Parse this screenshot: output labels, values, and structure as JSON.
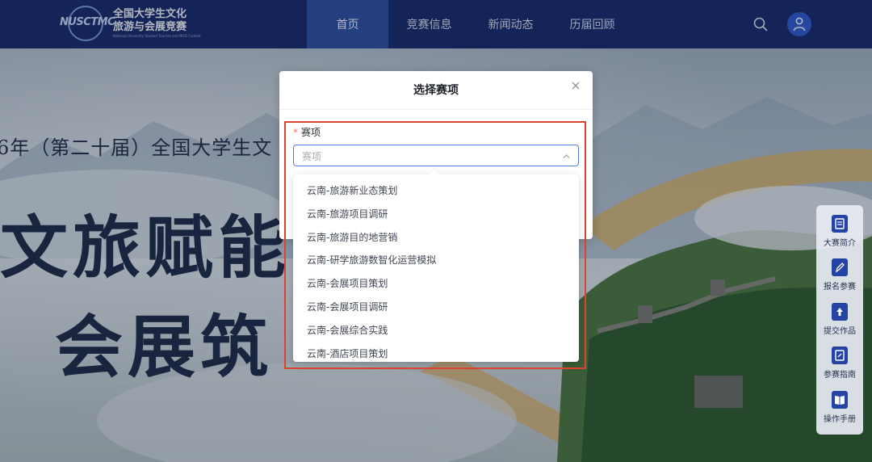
{
  "header": {
    "logo_abbr": "NUSCTMC",
    "logo_line1": "全国大学生文化",
    "logo_line2": "旅游与会展竞赛",
    "logo_line3": "National University Student Tourism and MICE Contest",
    "nav": [
      {
        "label": "首页",
        "active": true
      },
      {
        "label": "竞赛信息",
        "active": false
      },
      {
        "label": "新闻动态",
        "active": false
      },
      {
        "label": "历届回顾",
        "active": false
      }
    ]
  },
  "hero": {
    "subtitle": "6年（第二十届）全国大学生文",
    "line1": "文旅赋能",
    "line2": "会展筑"
  },
  "dialog": {
    "title": "选择赛项",
    "field_label": "赛项",
    "select_placeholder": "赛项",
    "options": [
      "云南-旅游新业态策划",
      "云南-旅游项目调研",
      "云南-旅游目的地营销",
      "云南-研学旅游数智化运营模拟",
      "云南-会展项目策划",
      "云南-会展项目调研",
      "云南-会展综合实践",
      "云南-酒店项目策划"
    ]
  },
  "side_tools": [
    {
      "label": "大赛简介",
      "icon": "document-icon"
    },
    {
      "label": "报名参赛",
      "icon": "edit-icon"
    },
    {
      "label": "提交作品",
      "icon": "upload-icon"
    },
    {
      "label": "参赛指南",
      "icon": "guide-icon"
    },
    {
      "label": "操作手册",
      "icon": "book-icon"
    }
  ],
  "colors": {
    "nav_bg": "#16266b",
    "nav_active": "#2d4fa6",
    "accent": "#2e5bd3",
    "highlight_border": "#d9432f",
    "required": "#f56c6c"
  }
}
